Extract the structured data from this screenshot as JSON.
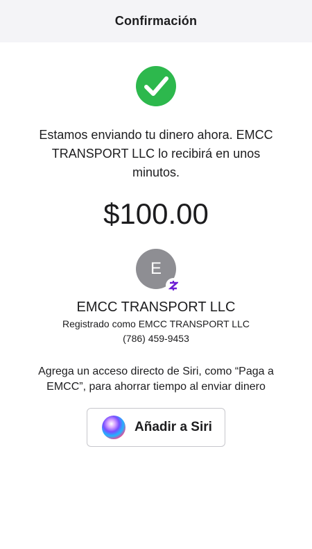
{
  "header": {
    "title": "Confirmación"
  },
  "status": {
    "icon": "check-circle-icon",
    "color": "#2db84d"
  },
  "message": {
    "line1": "Estamos enviando tu dinero ahora. EMCC",
    "line2": "TRANSPORT LLC  lo recibirá en unos",
    "line3": "minutos."
  },
  "amount": "$100.00",
  "recipient": {
    "initial": "E",
    "name": "EMCC TRANSPORT LLC",
    "registered": "Registrado como EMCC TRANSPORT LLC",
    "phone": "(786) 459-9453",
    "badge_icon": "zelle-icon",
    "badge_color": "#6d1ed4"
  },
  "siri": {
    "hint_line1": "Agrega un acceso directo de Siri, como “Paga a",
    "hint_line2": "EMCC”, para ahorrar tiempo al enviar dinero",
    "button_label": "Añadir a Siri",
    "icon": "siri-icon"
  }
}
